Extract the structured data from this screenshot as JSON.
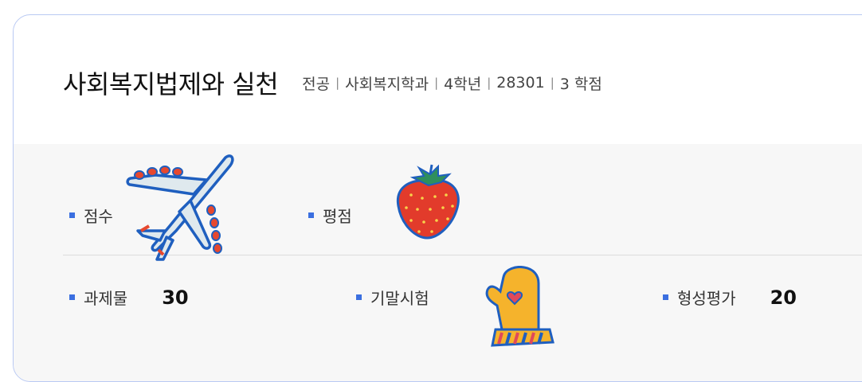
{
  "course": {
    "title": "사회복지법제와 실천",
    "meta": [
      "전공",
      "사회복지학과",
      "4학년",
      "28301",
      "3 학점"
    ],
    "meta_separator": "|"
  },
  "grading": {
    "row1": [
      {
        "label": "점수",
        "value": ""
      },
      {
        "label": "평점",
        "value": ""
      }
    ],
    "row2": [
      {
        "label": "과제물",
        "value": "30"
      },
      {
        "label": "기말시험",
        "value": ""
      },
      {
        "label": "형성평가",
        "value": "20"
      }
    ]
  },
  "colors": {
    "accent": "#3b6fe0",
    "card_border": "#b9c9f3",
    "band_bg": "#f7f7f7"
  },
  "stickers": [
    "airplane-icon",
    "strawberry-icon",
    "oven-mitt-icon"
  ]
}
